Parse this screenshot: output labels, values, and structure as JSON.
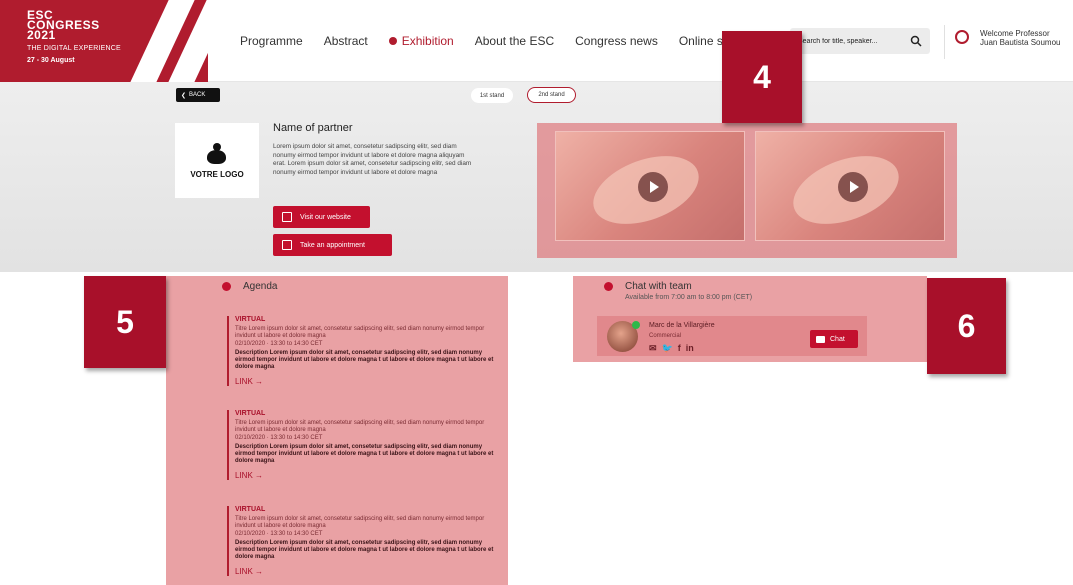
{
  "header": {
    "logo": {
      "line1": "ESC",
      "line2": "CONGRESS",
      "line3": "2021",
      "subtitle": "THE DIGITAL EXPERIENCE",
      "dates": "27 - 30 August"
    },
    "nav": [
      "Programme",
      "Abstract",
      "Exhibition",
      "About the ESC",
      "Congress news",
      "Online s"
    ],
    "active_nav": "Exhibition",
    "search_placeholder": "Search for title, speaker...",
    "welcome_line1": "Welcome Professor",
    "welcome_line2": "Juan Bautista Soumou"
  },
  "stand": {
    "back_label": "BACK",
    "tab1": "1st stand",
    "tab2": "2nd stand",
    "logo_text": "VOTRE LOGO",
    "partner_name": "Name of partner",
    "description": "Lorem ipsum dolor sit amet, consetetur sadipscing elitr, sed diam nonumy eirmod tempor invidunt ut labore et dolore magna aliquyam erat. Lorem ipsum dolor sit amet, consetetur sadipscing elitr, sed diam nonumy eirmod tempor invidunt ut labore et dolore magna",
    "visit_label": "Visit our website",
    "appointment_label": "Take an appointment"
  },
  "badges": {
    "b4": "4",
    "b5": "5",
    "b6": "6"
  },
  "agenda": {
    "title": "Agenda",
    "items": [
      {
        "type": "VIRTUAL",
        "title": "Titre Lorem ipsum dolor sit amet, consetetur sadipscing elitr, sed diam nonumy eirmod tempor invidunt ut labore et dolore magna",
        "date": "02/10/2020 · 13:30 to 14:30 CET",
        "desc": "Description Lorem ipsum dolor sit amet, consetetur sadipscing elitr, sed diam nonumy eirmod tempor invidunt ut labore et dolore magna t ut labore et dolore magna t ut labore et dolore magna",
        "link": "LINK →"
      },
      {
        "type": "VIRTUAL",
        "title": "Titre Lorem ipsum dolor sit amet, consetetur sadipscing elitr, sed diam nonumy eirmod tempor invidunt ut labore et dolore magna",
        "date": "02/10/2020 · 13:30 to 14:30 CET",
        "desc": "Description Lorem ipsum dolor sit amet, consetetur sadipscing elitr, sed diam nonumy eirmod tempor invidunt ut labore et dolore magna t ut labore et dolore magna t ut labore et dolore magna",
        "link": "LINK →"
      },
      {
        "type": "VIRTUAL",
        "title": "Titre Lorem ipsum dolor sit amet, consetetur sadipscing elitr, sed diam nonumy eirmod tempor invidunt ut labore et dolore magna",
        "date": "02/10/2020 · 13:30 to 14:30 CET",
        "desc": "Description Lorem ipsum dolor sit amet, consetetur sadipscing elitr, sed diam nonumy eirmod tempor invidunt ut labore et dolore magna t ut labore et dolore magna t ut labore et dolore magna",
        "link": "LINK →"
      }
    ]
  },
  "chat": {
    "title": "Chat with team",
    "availability": "Available from 7:00 am to 8:00 pm (CET)",
    "person_name": "Marc de la Villargière",
    "person_role": "Commercial",
    "social": [
      "✉",
      "🐦",
      "f",
      "in"
    ],
    "chat_label": "Chat"
  },
  "colors": {
    "brand": "#b01c2e",
    "button": "#c3102e",
    "badge": "#a8102a"
  }
}
